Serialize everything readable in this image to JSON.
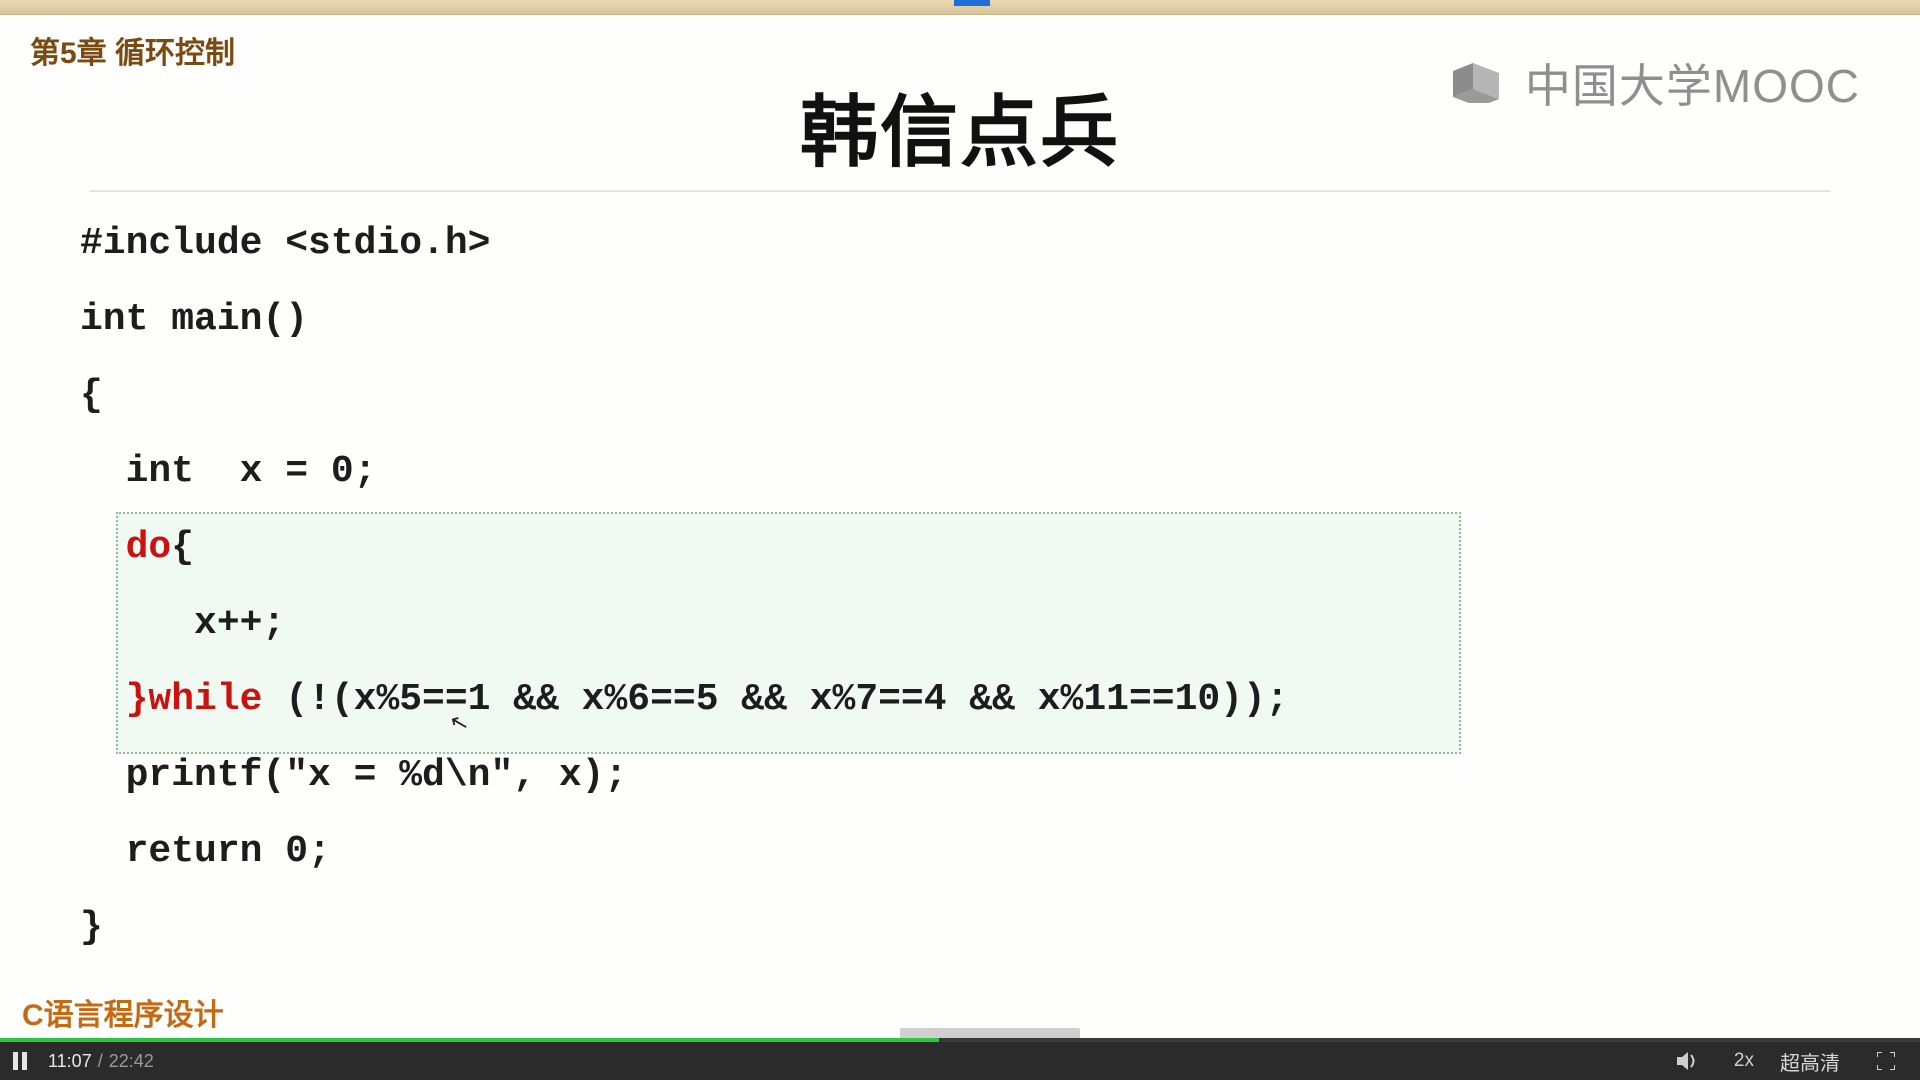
{
  "chapter": "第5章 循环控制",
  "title": "韩信点兵",
  "brand": {
    "text": "中国大学MOOC"
  },
  "footer": "C语言程序设计",
  "code": {
    "l1": "#include <stdio.h>",
    "l2": "int main()",
    "l3": "{",
    "l4": "  int  x = 0;",
    "l5a": "  do",
    "l5b": "{",
    "l6": "     x++;",
    "l7a": "  }while ",
    "l7b": "(!(x%5==1 && x%6==5 && x%7==4 && x%11==10));",
    "l8": "  printf(\"x = %d\\n\", x);",
    "l9": "  return 0;",
    "l10": "}"
  },
  "player": {
    "current_time": "11:07",
    "duration": "22:42",
    "speed": "2x",
    "quality": "超高清",
    "progress_percent": 48.9
  }
}
